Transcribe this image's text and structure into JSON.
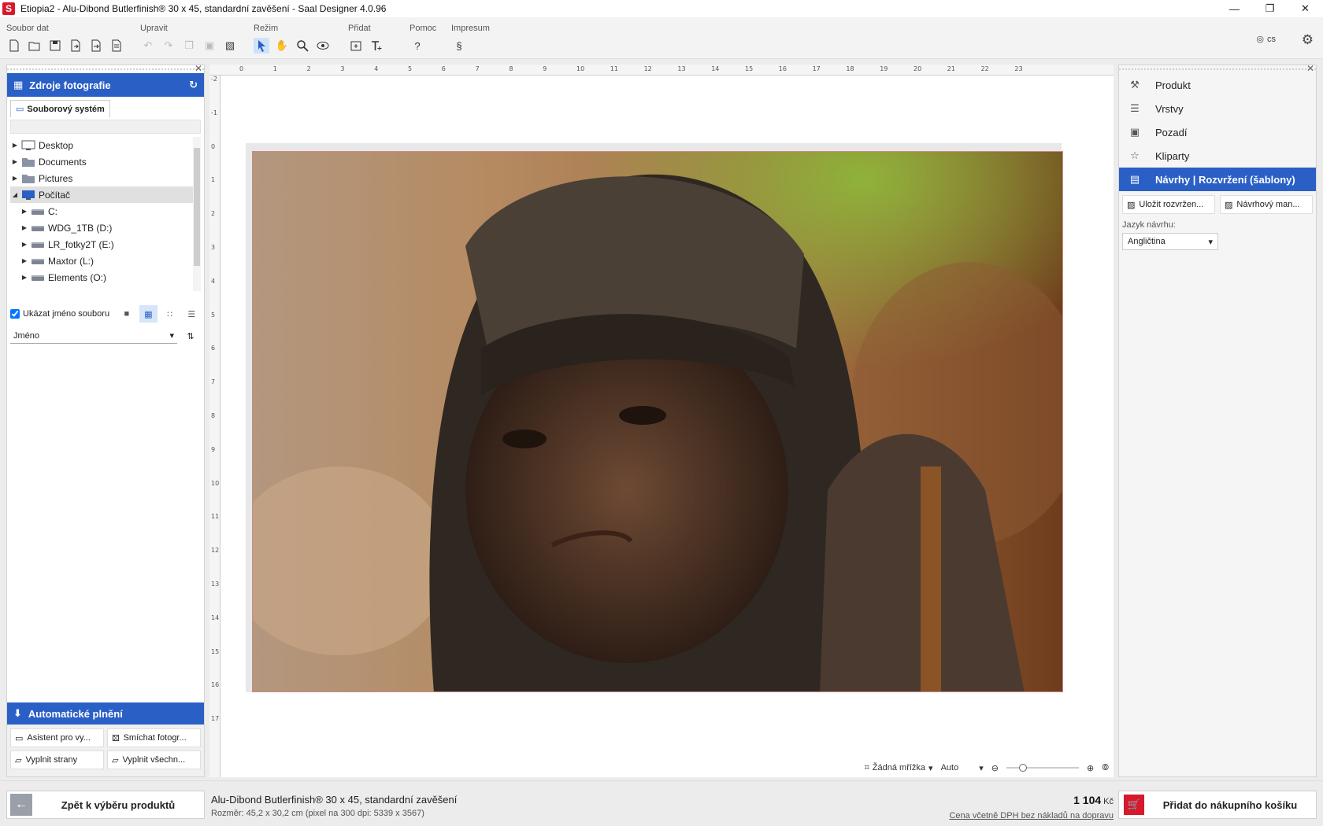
{
  "window": {
    "title": "Etiopia2 - Alu-Dibond Butlerfinish® 30 x 45, standardní zavěšení - Saal Designer 4.0.96",
    "logo": "S"
  },
  "toolbar": {
    "groups": [
      {
        "label": "Soubor dat",
        "icons": [
          "new-file-icon",
          "open-folder-icon",
          "save-icon",
          "save-as-icon",
          "export-icon",
          "import-icon"
        ]
      },
      {
        "label": "Upravit",
        "icons": [
          "undo-icon",
          "redo-icon",
          "copy-icon",
          "paste-icon",
          "image-edit-icon"
        ]
      },
      {
        "label": "Režim",
        "icons": [
          "pointer-icon",
          "hand-icon",
          "zoom-icon",
          "preview-eye-icon"
        ]
      },
      {
        "label": "Přidat",
        "icons": [
          "add-image-icon",
          "add-text-icon"
        ]
      },
      {
        "label": "Pomoc",
        "icons": [
          "help-icon"
        ]
      },
      {
        "label": "Impresum",
        "icons": [
          "section-icon"
        ]
      }
    ],
    "help_glyph": "?",
    "section_glyph": "§",
    "language": "cs"
  },
  "left_panel": {
    "header": "Zdroje fotografie",
    "tab": "Souborový systém",
    "tree": [
      {
        "label": "Desktop",
        "icon": "desktop-icon",
        "level": 0,
        "expanded": false
      },
      {
        "label": "Documents",
        "icon": "documents-folder-icon",
        "level": 0,
        "expanded": false
      },
      {
        "label": "Pictures",
        "icon": "pictures-folder-icon",
        "level": 0,
        "expanded": false
      },
      {
        "label": "Počítač",
        "icon": "computer-icon",
        "level": 0,
        "expanded": true,
        "selected": true
      },
      {
        "label": "C:",
        "icon": "drive-icon",
        "level": 1,
        "expanded": false
      },
      {
        "label": "WDG_1TB (D:)",
        "icon": "drive-icon",
        "level": 1,
        "expanded": false
      },
      {
        "label": "LR_fotky2T (E:)",
        "icon": "drive-icon",
        "level": 1,
        "expanded": false
      },
      {
        "label": "Maxtor (L:)",
        "icon": "drive-icon",
        "level": 1,
        "expanded": false
      },
      {
        "label": "Elements (O:)",
        "icon": "drive-icon",
        "level": 1,
        "expanded": false
      }
    ],
    "show_filename_label": "Ukázat jméno souboru",
    "show_filename_checked": true,
    "sort_label": "Jméno",
    "auto_fill": {
      "header": "Automatické plnění",
      "buttons": [
        "Asistent pro vy...",
        "Smíchat fotogr...",
        "Vyplnit strany",
        "Vyplnit všechn..."
      ]
    }
  },
  "canvas": {
    "ruler_top": [
      "0",
      "1",
      "2",
      "3",
      "4",
      "5",
      "6",
      "7",
      "8",
      "9",
      "10",
      "11",
      "12",
      "13",
      "14",
      "15",
      "16",
      "17",
      "18",
      "19",
      "20",
      "21",
      "22",
      "23"
    ],
    "ruler_left": [
      "-2",
      "-1",
      "0",
      "1",
      "2",
      "3",
      "4",
      "5",
      "6",
      "7",
      "8",
      "9",
      "10",
      "11",
      "12",
      "13",
      "14",
      "15",
      "16",
      "17"
    ],
    "grid_label": "Žádná mřížka",
    "zoom_mode": "Auto"
  },
  "right_panel": {
    "items": [
      {
        "label": "Produkt",
        "icon": "wrench-icon",
        "active": false
      },
      {
        "label": "Vrstvy",
        "icon": "layers-icon",
        "active": false
      },
      {
        "label": "Pozadí",
        "icon": "background-icon",
        "active": false
      },
      {
        "label": "Kliparty",
        "icon": "clipart-icon",
        "active": false
      },
      {
        "label": "Návrhy | Rozvržení (šablony)",
        "icon": "templates-icon",
        "active": true
      }
    ],
    "btn_save_layout": "Uložit rozvržen...",
    "btn_design_manager": "Návrhový man...",
    "design_language_label": "Jazyk návrhu:",
    "design_language_value": "Angličtina"
  },
  "bottom": {
    "back_label": "Zpět k výběru produktů",
    "product_name": "Alu-Dibond Butlerfinish® 30 x 45, standardní zavěšení",
    "product_size": "Rozměr: 45,2 x 30,2 cm (pixel na 300 dpi: 5339 x 3567)",
    "price": "1 104",
    "currency": "Kč",
    "price_note": "Cena včetně DPH bez nákladů na dopravu",
    "cart_label": "Přidat do nákupního košíku"
  },
  "colors": {
    "accent": "#2a5fc6",
    "brand": "#d7192c"
  }
}
